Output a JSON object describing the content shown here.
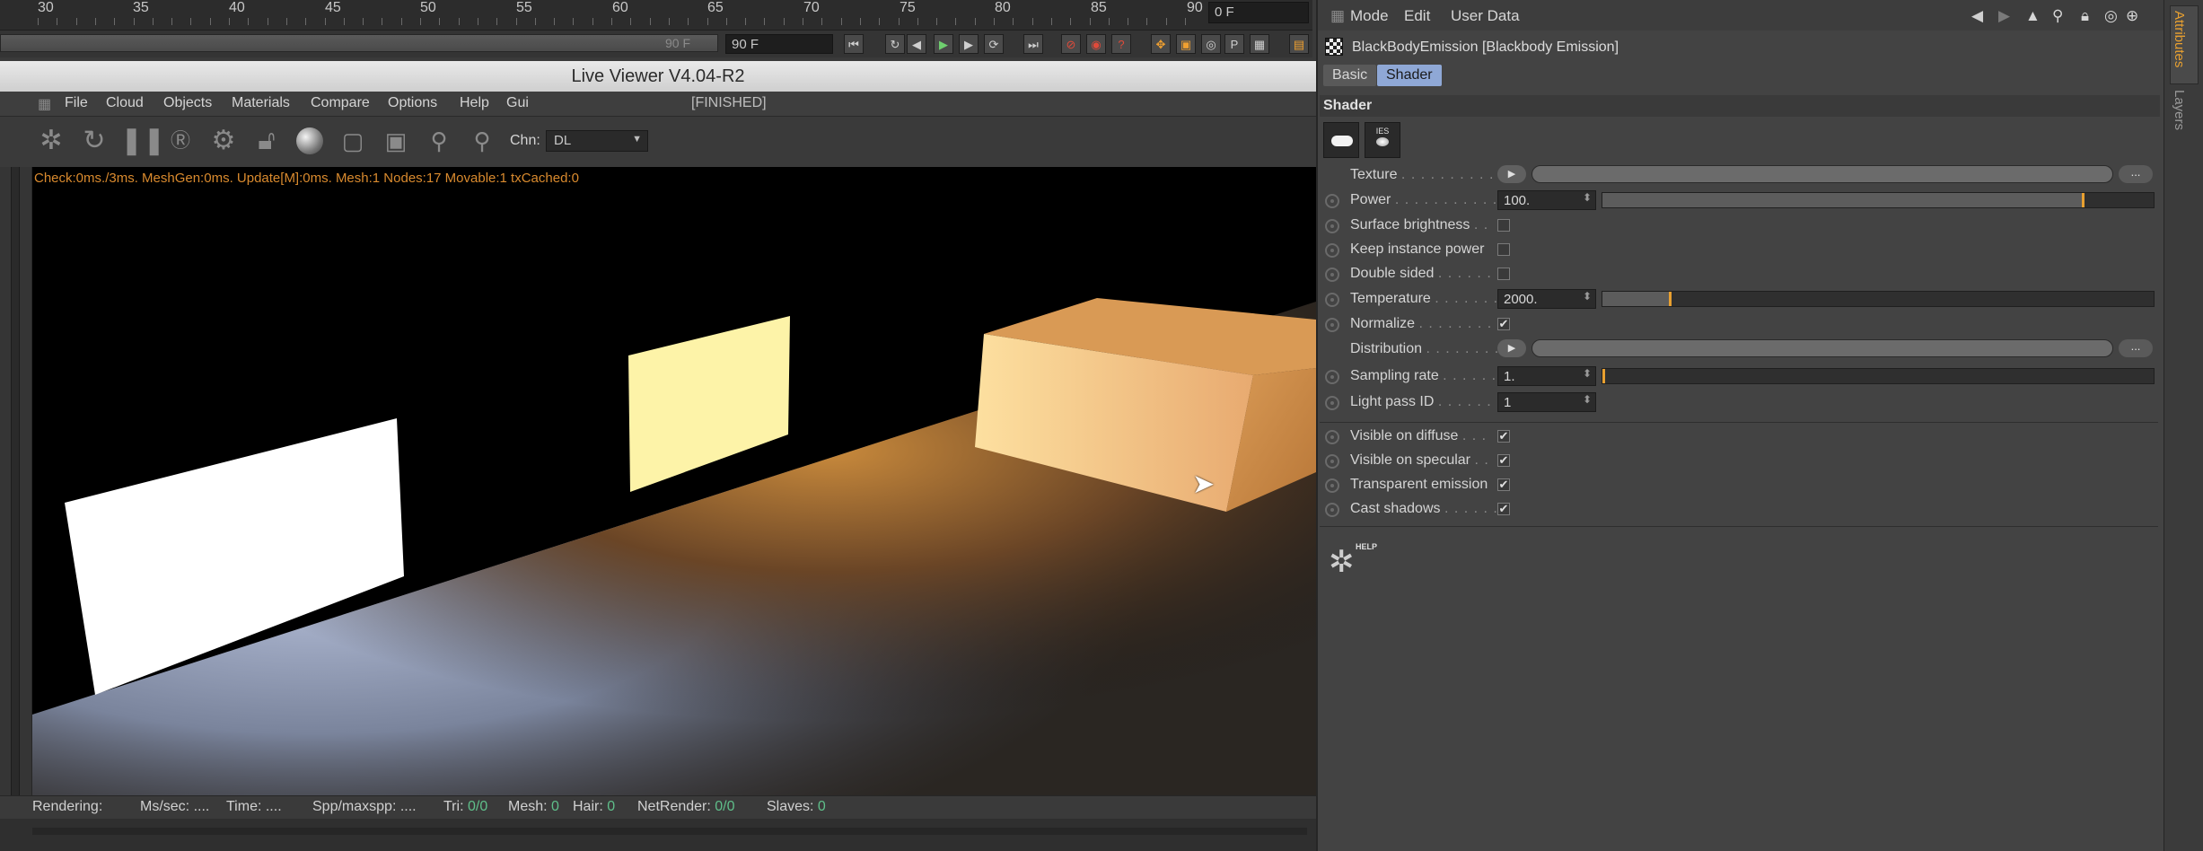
{
  "timeline": {
    "ticks": [
      "30",
      "35",
      "40",
      "45",
      "50",
      "55",
      "60",
      "65",
      "70",
      "75",
      "80",
      "85",
      "90"
    ],
    "current_frame": "0 F",
    "end_frame_dim": "90 F",
    "end_frame": "90 F"
  },
  "live_viewer": {
    "title": "Live Viewer V4.04-R2",
    "menu": [
      "File",
      "Cloud",
      "Objects",
      "Materials",
      "Compare",
      "Options",
      "Help",
      "Gui"
    ],
    "status_tag": "[FINISHED]",
    "channel_label": "Chn:",
    "channel_value": "DL",
    "stats": "Check:0ms./3ms. MeshGen:0ms. Update[M]:0ms. Mesh:1 Nodes:17 Movable:1 txCached:0",
    "statusbar": {
      "rendering": "Rendering:",
      "ms_sec": "Ms/sec: ....",
      "time": "Time: ....",
      "spp": "Spp/maxspp: ....",
      "tri_label": "Tri:",
      "tri": "0/0",
      "mesh_label": "Mesh:",
      "mesh": "0",
      "hair_label": "Hair:",
      "hair": "0",
      "net_label": "NetRender:",
      "net": "0/0",
      "slaves_label": "Slaves:",
      "slaves": "0"
    }
  },
  "attributes": {
    "menu": [
      "Mode",
      "Edit",
      "User Data"
    ],
    "object_title": "BlackBodyEmission [Blackbody Emission]",
    "tabs": [
      "Basic",
      "Shader"
    ],
    "active_tab": "Shader",
    "section": "Shader",
    "rows": {
      "texture": "Texture",
      "power": "Power",
      "power_value": "100.",
      "power_level": 0.87,
      "surface_brightness": "Surface brightness",
      "keep_instance_power": "Keep instance power",
      "double_sided": "Double sided",
      "temperature": "Temperature",
      "temperature_value": "2000.",
      "temperature_level": 0.12,
      "normalize": "Normalize",
      "distribution": "Distribution",
      "sampling_rate": "Sampling rate",
      "sampling_value": "1.",
      "light_pass_id": "Light pass ID",
      "light_pass_value": "1",
      "visible_diffuse": "Visible on diffuse",
      "visible_specular": "Visible on specular",
      "transparent_emission": "Transparent emission",
      "cast_shadows": "Cast shadows"
    },
    "ellipsis": "...",
    "help_label": "HELP",
    "side_tabs": [
      "Attributes",
      "Layers"
    ]
  },
  "colors": {
    "accent_orange": "#e8a030",
    "active_tab": "#8fa8d6",
    "stats_text": "#d98a2e",
    "status_green": "#5fbf8a"
  }
}
